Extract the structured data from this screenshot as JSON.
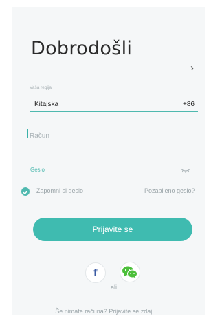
{
  "header": {
    "title": "Dobrodošli"
  },
  "region": {
    "label": "Vaša regija",
    "value": "Kitajska",
    "code": "+86"
  },
  "account": {
    "placeholder": "Račun"
  },
  "password": {
    "label": "Geslo"
  },
  "options": {
    "remember_label": "Zapomni si geslo",
    "forgot_label": "Pozabljeno geslo?"
  },
  "login": {
    "button_label": "Prijavite se"
  },
  "social": {
    "or_label": "ali",
    "facebook_glyph": "f"
  },
  "footer": {
    "signup_text": "Še nimate računa? Prijavite se zdaj."
  },
  "colors": {
    "accent": "#3fbbb0",
    "facebook": "#3b5ba3",
    "wechat": "#4cbf3a"
  }
}
